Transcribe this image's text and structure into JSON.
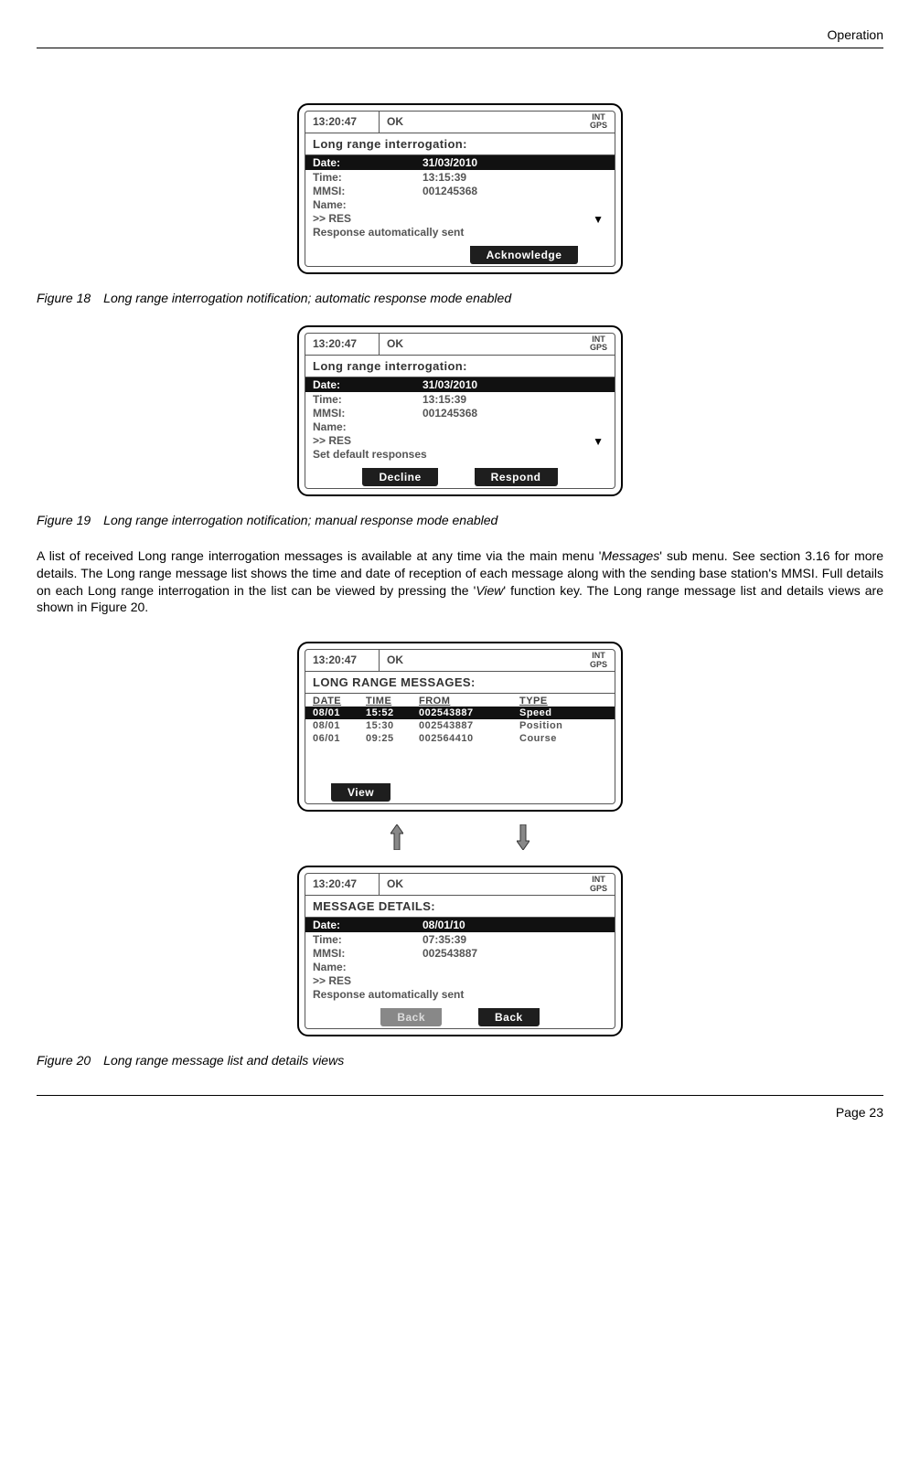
{
  "header": {
    "section": "Operation"
  },
  "footer": {
    "pagelabel": "Page 23"
  },
  "fig18": {
    "status": {
      "time": "13:20:47",
      "ok": "OK",
      "int": "INT",
      "gps": "GPS"
    },
    "title": "Long range interrogation:",
    "hi": {
      "label": "Date:",
      "value": "31/03/2010"
    },
    "rows": [
      {
        "label": "Time:",
        "value": "13:15:39"
      },
      {
        "label": "MMSI:",
        "value": "001245368"
      },
      {
        "label": "Name:",
        "value": ""
      },
      {
        "label": ">> RES",
        "value": ""
      }
    ],
    "footer_line": "Response automatically sent",
    "softkeys": {
      "right": "Acknowledge"
    },
    "caption_num": "Figure 18",
    "caption_text": "Long range interrogation notification; automatic response mode enabled"
  },
  "fig19": {
    "status": {
      "time": "13:20:47",
      "ok": "OK",
      "int": "INT",
      "gps": "GPS"
    },
    "title": "Long range interrogation:",
    "hi": {
      "label": "Date:",
      "value": "31/03/2010"
    },
    "rows": [
      {
        "label": "Time:",
        "value": "13:15:39"
      },
      {
        "label": "MMSI:",
        "value": "001245368"
      },
      {
        "label": "Name:",
        "value": ""
      },
      {
        "label": ">> RES",
        "value": ""
      }
    ],
    "footer_line": "Set default responses",
    "softkeys": {
      "left": "Decline",
      "right": "Respond"
    },
    "caption_num": "Figure 19",
    "caption_text": "Long range interrogation notification; manual response mode enabled"
  },
  "body_para": {
    "t1": "A list of received Long range interrogation messages is available at any time via the main menu '",
    "i1": "Messages",
    "t2": "' sub menu. See section 3.16 for more details. The Long range message list shows the time and date of reception of each message along with the sending base station's MMSI. Full details on each Long range interrogation in the list can be viewed by pressing the '",
    "i2": "View",
    "t3": "' function key. The Long range message list and details views are shown in Figure 20."
  },
  "fig20a": {
    "status": {
      "time": "13:20:47",
      "ok": "OK",
      "int": "INT",
      "gps": "GPS"
    },
    "title": "LONG RANGE MESSAGES:",
    "head": {
      "date": "DATE",
      "time": "TIME",
      "from": "FROM",
      "type": "TYPE"
    },
    "rows": [
      {
        "date": "08/01",
        "time": "15:52",
        "from": "002543887",
        "type": "Speed",
        "hi": true
      },
      {
        "date": "08/01",
        "time": "15:30",
        "from": "002543887",
        "type": "Position",
        "hi": false
      },
      {
        "date": "06/01",
        "time": "09:25",
        "from": "002564410",
        "type": "Course",
        "hi": false
      }
    ],
    "softkeys": {
      "left": "View"
    }
  },
  "fig20b": {
    "status": {
      "time": "13:20:47",
      "ok": "OK",
      "int": "INT",
      "gps": "GPS"
    },
    "title": "MESSAGE DETAILS:",
    "hi": {
      "label": "Date:",
      "value": "08/01/10"
    },
    "rows": [
      {
        "label": "Time:",
        "value": "07:35:39"
      },
      {
        "label": "MMSI:",
        "value": "002543887"
      },
      {
        "label": "Name:",
        "value": ""
      },
      {
        "label": ">> RES",
        "value": ""
      }
    ],
    "footer_line": "Response automatically sent",
    "softkeys": {
      "dim": "Back",
      "right": "Back"
    }
  },
  "fig20caption": {
    "num": "Figure 20",
    "text": "Long range message list and details views"
  }
}
